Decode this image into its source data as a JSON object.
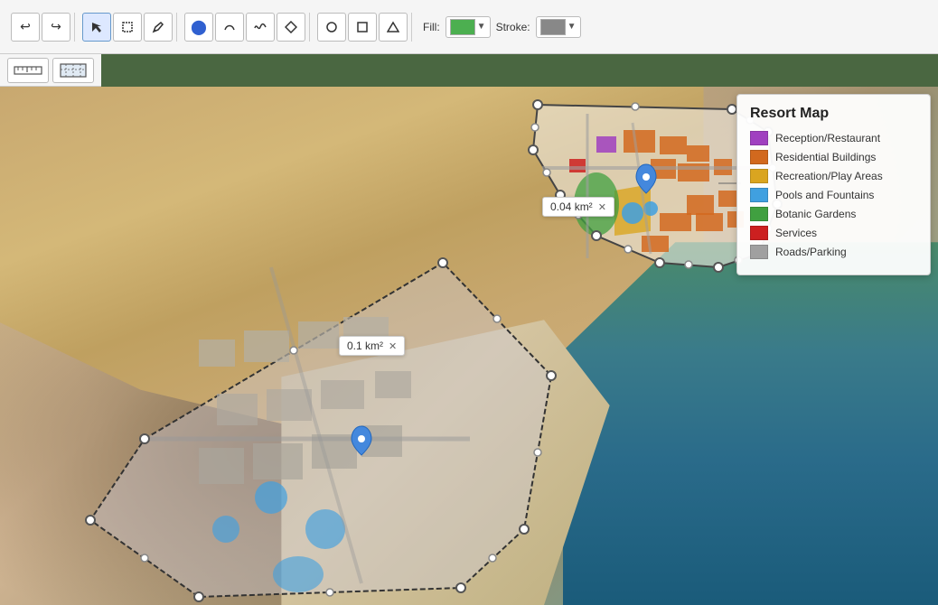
{
  "toolbar": {
    "undo_label": "↩",
    "redo_label": "↪",
    "select_label": "↖",
    "rect_select_label": "⬜",
    "pencil_label": "✏",
    "point_label": "⬤",
    "curve_label": "↗",
    "smooth_label": "~",
    "node_label": "◆",
    "circle_label": "○",
    "square_label": "▭",
    "triangle_label": "△",
    "fill_label": "Fill:",
    "stroke_label": "Stroke:",
    "fill_color": "#4CAF50",
    "stroke_color": "#888888"
  },
  "measure": {
    "ruler_label": "━━",
    "area_label": "▦"
  },
  "map": {
    "upper_area_label": "0.04 km²",
    "lower_area_label": "0.1 km²"
  },
  "legend": {
    "title": "Resort Map",
    "items": [
      {
        "id": "reception",
        "color": "#A040C0",
        "label": "Reception/Restaurant"
      },
      {
        "id": "residential",
        "color": "#D2691E",
        "label": "Residential Buildings"
      },
      {
        "id": "recreation",
        "color": "#DAA520",
        "label": "Recreation/Play Areas"
      },
      {
        "id": "pools",
        "color": "#40A0E0",
        "label": "Pools and Fountains"
      },
      {
        "id": "botanic",
        "color": "#40A040",
        "label": "Botanic Gardens"
      },
      {
        "id": "services",
        "color": "#CC2020",
        "label": "Services"
      },
      {
        "id": "roads",
        "color": "#A0A0A0",
        "label": "Roads/Parking"
      }
    ]
  }
}
